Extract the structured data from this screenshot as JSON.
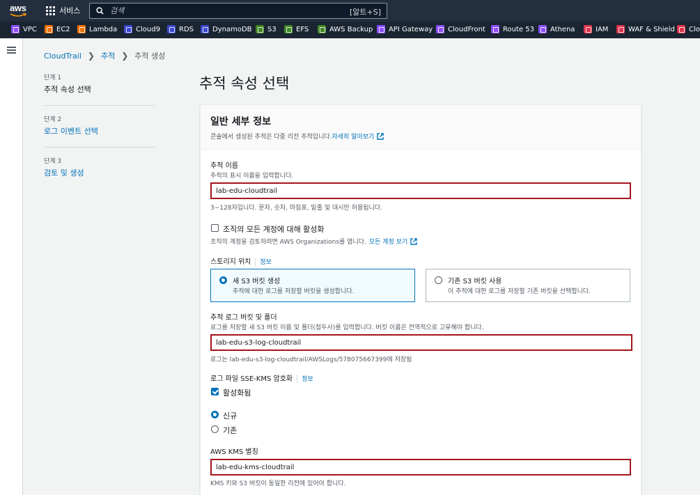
{
  "topnav": {
    "logo_text": "aws",
    "services_label": "서비스",
    "search_placeholder": "검색",
    "search_hint": "[알트+S]"
  },
  "favorites": [
    {
      "label": "VPC",
      "color": "#8c4fff",
      "icon": "vpc-icon"
    },
    {
      "label": "EC2",
      "color": "#ed7100",
      "icon": "ec2-icon"
    },
    {
      "label": "Lambda",
      "color": "#ed7100",
      "icon": "lambda-icon"
    },
    {
      "label": "Cloud9",
      "color": "#3b48cc",
      "icon": "cloud9-icon"
    },
    {
      "label": "RDS",
      "color": "#3b48cc",
      "icon": "rds-icon"
    },
    {
      "label": "DynamoDB",
      "color": "#3b48cc",
      "icon": "dynamodb-icon"
    },
    {
      "label": "S3",
      "color": "#3f8624",
      "icon": "s3-icon"
    },
    {
      "label": "EFS",
      "color": "#3f8624",
      "icon": "efs-icon"
    },
    {
      "label": "AWS Backup",
      "color": "#3f8624",
      "icon": "backup-icon"
    },
    {
      "label": "API Gateway",
      "color": "#8c4fff",
      "icon": "api-gateway-icon"
    },
    {
      "label": "CloudFront",
      "color": "#8c4fff",
      "icon": "cloudfront-icon"
    },
    {
      "label": "Route 53",
      "color": "#8c4fff",
      "icon": "route53-icon"
    },
    {
      "label": "Athena",
      "color": "#8c4fff",
      "icon": "athena-icon"
    },
    {
      "label": "IAM",
      "color": "#dd344c",
      "icon": "iam-icon"
    },
    {
      "label": "WAF & Shield",
      "color": "#dd344c",
      "icon": "waf-icon"
    },
    {
      "label": "Clo",
      "color": "#dd344c",
      "icon": "cloud-icon"
    }
  ],
  "breadcrumb": {
    "item1": "CloudTrail",
    "item2": "추적",
    "current": "추적 생성"
  },
  "steps": [
    {
      "num": "단계 1",
      "label": "추적 속성 선택"
    },
    {
      "num": "단계 2",
      "label": "로그 이벤트 선택"
    },
    {
      "num": "단계 3",
      "label": "검토 및 생성"
    }
  ],
  "page_title": "추적 속성 선택",
  "card": {
    "title": "일반 세부 정보",
    "description": "콘솔에서 생성된 추적은 다중 리전 추적입니다.",
    "learn_more": "자세히 알아보기"
  },
  "trail_name": {
    "label": "추적 이름",
    "desc": "추적의 표시 이름을 입력합니다.",
    "value": "lab-edu-cloudtrail",
    "constraint": "3~128자입니다. 문자, 숫자, 마침표, 밑줄 및 대시만 허용됩니다."
  },
  "org": {
    "checkbox_label": "조직의 모든 계정에 대해 활성화",
    "desc": "조직의 계정을 검토하려면 AWS Organizations를 엽니다.",
    "link": "모든 계정 보기"
  },
  "storage": {
    "label": "스토리지 위치",
    "info": "정보",
    "new_title": "새 S3 버킷 생성",
    "new_desc": "추적에 대한 로그를 저장할 버킷을 생성합니다.",
    "existing_title": "기존 S3 버킷 사용",
    "existing_desc": "이 추적에 대한 로그를 저장할 기존 버킷을 선택합니다."
  },
  "bucket": {
    "label": "추적 로그 버킷 및 폴더",
    "desc": "로그를 저장할 새 S3 버킷 이름 및 폴더(접두사)를 입력합니다. 버킷 이름은 전역적으로 고유해야 합니다.",
    "value": "lab-edu-s3-log-cloudtrail",
    "note": "로그는 lab-edu-s3-log-cloudtrail/AWSLogs/578075667399에 저장됨"
  },
  "sse": {
    "label": "로그 파일 SSE-KMS 암호화",
    "info": "정보",
    "enabled_label": "활성화됨",
    "new_label": "신규",
    "existing_label": "기존"
  },
  "kms": {
    "label": "AWS KMS 별칭",
    "value": "lab-edu-kms-cloudtrail",
    "note": "KMS 키와 S3 버킷이 동일한 리전에 있어야 합니다."
  },
  "colors": {
    "nav_bg": "#232f3e",
    "link": "#0073bb",
    "highlight_border": "#a5141b"
  }
}
